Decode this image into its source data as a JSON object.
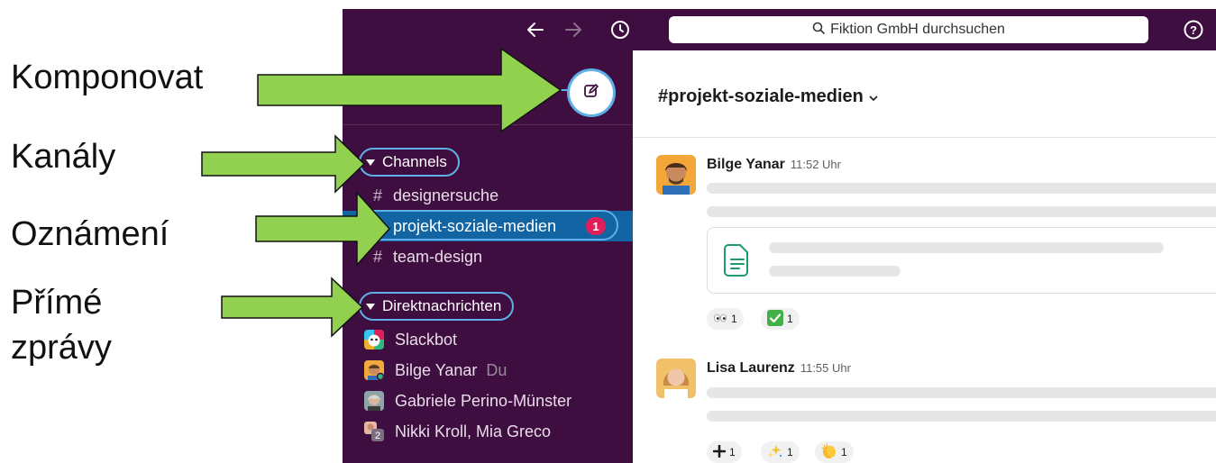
{
  "annotations": {
    "compose": "Komponovat",
    "channels": "Kanály",
    "notification": "Oznámení",
    "dm_line1": "Přímé",
    "dm_line2": "zprávy"
  },
  "topbar": {
    "back_icon": "arrow-left-icon",
    "forward_icon": "arrow-right-icon",
    "history_icon": "clock-icon",
    "search_placeholder": "Fiktion GmbH durchsuchen",
    "help_icon": "help-circle-icon"
  },
  "sidebar": {
    "compose_icon": "compose-icon",
    "channels_label": "Channels",
    "channels": [
      {
        "name": "designersuche"
      },
      {
        "name": "projekt-soziale-medien",
        "badge": "1"
      },
      {
        "name": "team-design"
      }
    ],
    "dm_label": "Direktnachrichten",
    "dms": [
      {
        "name": "Slackbot"
      },
      {
        "name": "Bilge Yanar",
        "suffix": "Du"
      },
      {
        "name": "Gabriele Perino-Münster"
      },
      {
        "name": "Nikki Kroll, Mia Greco",
        "count": "2"
      }
    ]
  },
  "channel": {
    "title": "#projekt-soziale-medien",
    "messages": [
      {
        "author": "Bilge Yanar",
        "time": "11:52 Uhr"
      },
      {
        "author": "Lisa Laurenz",
        "time": "11:55 Uhr"
      }
    ],
    "reactions_1": [
      {
        "icon": "eyes-emoji",
        "count": "1"
      },
      {
        "icon": "check-mark-emoji",
        "count": "1"
      }
    ],
    "reactions_2": [
      {
        "icon": "plus-emoji",
        "count": "1"
      },
      {
        "icon": "sparkles-emoji",
        "count": "1"
      },
      {
        "icon": "clapping-hands-emoji",
        "count": "1"
      }
    ]
  },
  "colors": {
    "sidebar": "#3f0e40",
    "active_channel": "#1264a3",
    "badge": "#e01e5a",
    "highlight": "#5fb0e6",
    "arrow_fill": "#92d050"
  }
}
